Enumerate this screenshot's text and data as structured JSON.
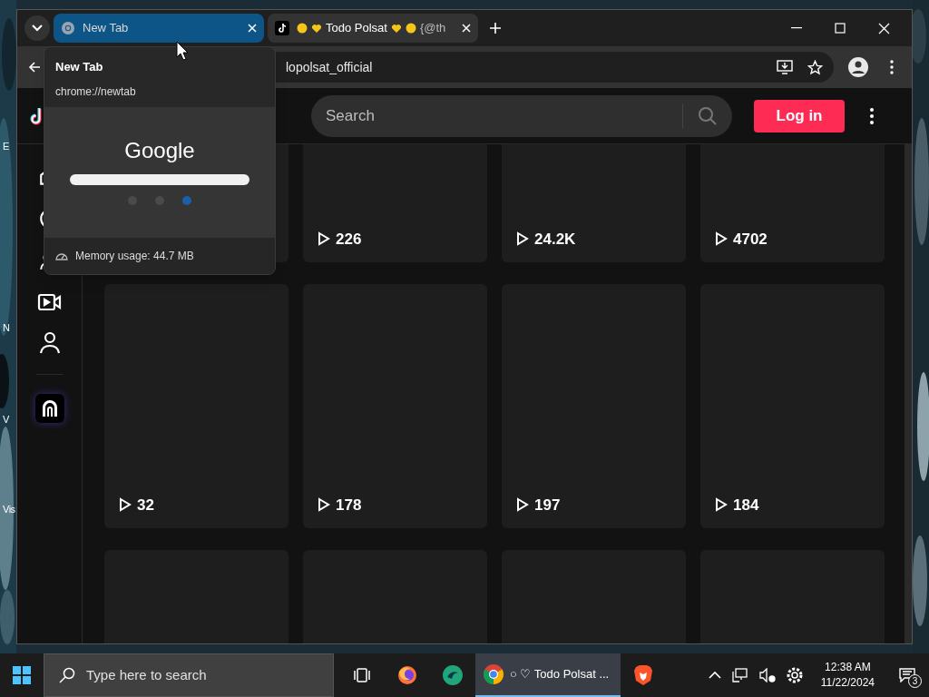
{
  "desktop": {
    "labels": [
      "E",
      "N",
      "V",
      "Vis"
    ]
  },
  "browser": {
    "tabs": [
      {
        "kind": "chrome",
        "title": "New Tab",
        "selected": false,
        "hovered": true
      },
      {
        "kind": "tiktok",
        "title": "Todo Polsat",
        "title_end": "{@th",
        "selected": true,
        "hovered": false
      }
    ],
    "address": "lopolsat_official",
    "hover_card": {
      "title": "New Tab",
      "url": "chrome://newtab",
      "preview_logo": "Google",
      "memory": "Memory usage: 44.7 MB"
    }
  },
  "page": {
    "search": {
      "placeholder": "Search"
    },
    "login": "Log in",
    "sidebar": [
      {
        "kind": "home"
      },
      {
        "kind": "explore"
      },
      {
        "kind": "following"
      },
      {
        "kind": "live"
      },
      {
        "kind": "profile"
      },
      {
        "kind": "tv"
      }
    ],
    "videos": [
      {
        "kind": "blank"
      },
      {
        "kind": "counted",
        "views": "226"
      },
      {
        "kind": "counted",
        "views": "24.2K"
      },
      {
        "kind": "counted",
        "views": "4702"
      },
      {
        "kind": "counted",
        "views": "32"
      },
      {
        "kind": "counted",
        "views": "178"
      },
      {
        "kind": "counted",
        "views": "197"
      },
      {
        "kind": "counted",
        "views": "184"
      },
      {
        "kind": "blank"
      },
      {
        "kind": "blank"
      },
      {
        "kind": "blank"
      },
      {
        "kind": "blank"
      }
    ]
  },
  "taskbar": {
    "search": {
      "placeholder": "Type here to search"
    },
    "apps": [
      {
        "kind": "taskview",
        "selected": false
      },
      {
        "kind": "firefox",
        "selected": false
      },
      {
        "kind": "green",
        "selected": false
      },
      {
        "kind": "chrome",
        "label": "○ ♡ Todo Polsat ...",
        "selected": true
      },
      {
        "kind": "brave",
        "selected": false
      }
    ],
    "time": "12:38 AM",
    "date": "11/22/2024",
    "notifications": "3"
  }
}
